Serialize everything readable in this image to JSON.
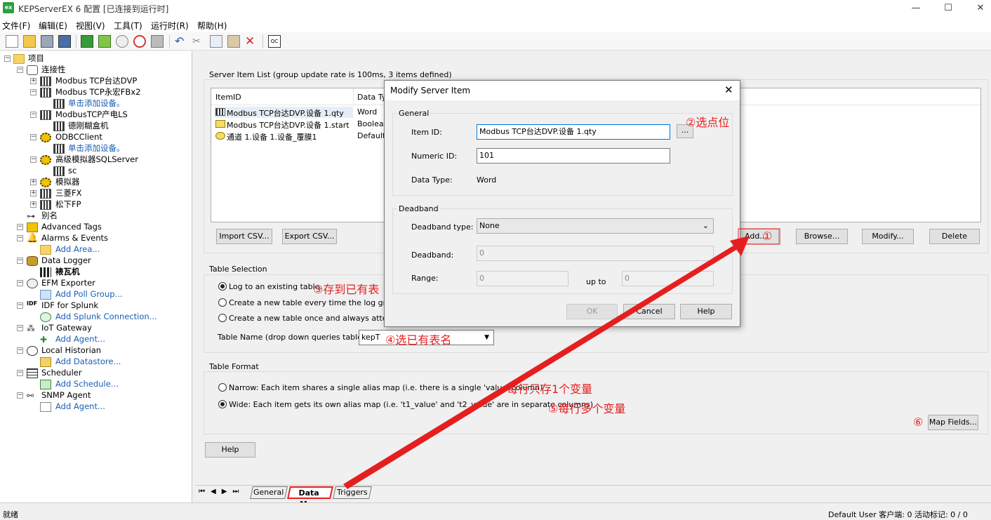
{
  "window": {
    "title": "KEPServerEX 6 配置 [已连接到运行时]",
    "app_icon": "ex",
    "min": "—",
    "max": "☐",
    "close": "✕"
  },
  "menu": [
    "文件(F)",
    "编辑(E)",
    "视图(V)",
    "工具(T)",
    "运行时(R)",
    "帮助(H)"
  ],
  "tree": {
    "root": "项目",
    "connectivity": "连接性",
    "items": {
      "dvp": "Modbus TCP台达DVP",
      "fbx2": "Modbus TCP永宏FBx2",
      "add1": "单击添加设备。",
      "chanls": "ModbusTCP产电LS",
      "dev_gh": "德刚糊盒机",
      "odbc": "ODBCClient",
      "add2": "单击添加设备。",
      "sqlsrv": "高级模拟器SQLServer",
      "sc": "sc",
      "sim": "模拟器",
      "mitsu": "三菱FX",
      "pana": "松下FP",
      "alias": "别名",
      "adv": "Advanced Tags",
      "alarms": "Alarms & Events",
      "addarea": "Add Area...",
      "logger": "Data Logger",
      "tile": "裱瓦机",
      "efm": "EFM Exporter",
      "addpoll": "Add Poll Group...",
      "idf": "IDF for Splunk",
      "addsplunk": "Add Splunk Connection...",
      "iot": "IoT Gateway",
      "addagent1": "Add Agent...",
      "hist": "Local Historian",
      "addds": "Add Datastore...",
      "sched": "Scheduler",
      "addsched": "Add Schedule...",
      "snmp": "SNMP Agent",
      "addagent2": "Add Agent..."
    }
  },
  "server_items": {
    "label": "Server Item List (group update rate is 100ms, 3 items defined)",
    "headers": [
      "ItemID",
      "Data Ty"
    ],
    "rows": [
      {
        "id": "Modbus TCP台达DVP.设备 1.qty",
        "type": "Word"
      },
      {
        "id": "Modbus TCP台达DVP.设备 1.start",
        "type": "Boolean"
      },
      {
        "id": "通道 1.设备 1.设备_覆膜1",
        "type": "Default"
      }
    ],
    "import": "Import CSV...",
    "export": "Export CSV...",
    "add": "Add...",
    "browse": "Browse...",
    "modify": "Modify...",
    "delete": "Delete"
  },
  "table_selection": {
    "label": "Table Selection",
    "opt1": "Log to an existing table.",
    "opt2": "Create a new table every time the log group is",
    "opt3": "Create a new table once and always attempt t",
    "name_label": "Table Name (drop down queries tables)",
    "name_value": "kepT"
  },
  "table_format": {
    "label": "Table Format",
    "narrow": "Narrow: Each item shares a single alias map (i.e. there is a single 'value' column)",
    "wide": "Wide: Each item gets its own alias map (i.e. 't1_value' and 't2_value' are in separate columns)",
    "map_fields": "Map Fields..."
  },
  "help": "Help",
  "tabs": [
    "General",
    "Data Map",
    "Triggers"
  ],
  "dialog": {
    "title": "Modify Server Item",
    "general": "General",
    "item_id_label": "Item ID:",
    "item_id": "Modbus TCP台达DVP.设备 1.qty",
    "numeric_id_label": "Numeric ID:",
    "numeric_id": "101",
    "data_type_label": "Data Type:",
    "data_type": "Word",
    "deadband": "Deadband",
    "db_type_label": "Deadband type:",
    "db_type": "None",
    "db_label": "Deadband:",
    "db_value": "0",
    "range_label": "Range:",
    "range_lo": "0",
    "upto": "up to",
    "range_hi": "0",
    "ok": "OK",
    "cancel": "Cancel",
    "help": "Help",
    "browse": "..."
  },
  "annotations": {
    "a1": "①",
    "a2": "②选点位",
    "a3": "③存到已有表",
    "a4": "④选已有表名",
    "a5a": "每行只存1个变量",
    "a5": "⑤每行多个变量",
    "a6": "⑥"
  },
  "status": {
    "left": "就绪",
    "right": "Default User   客户端: 0   活动标记: 0 / 0"
  },
  "colors": {
    "annotation": "#e51f1f",
    "link": "#1a5fb4"
  }
}
